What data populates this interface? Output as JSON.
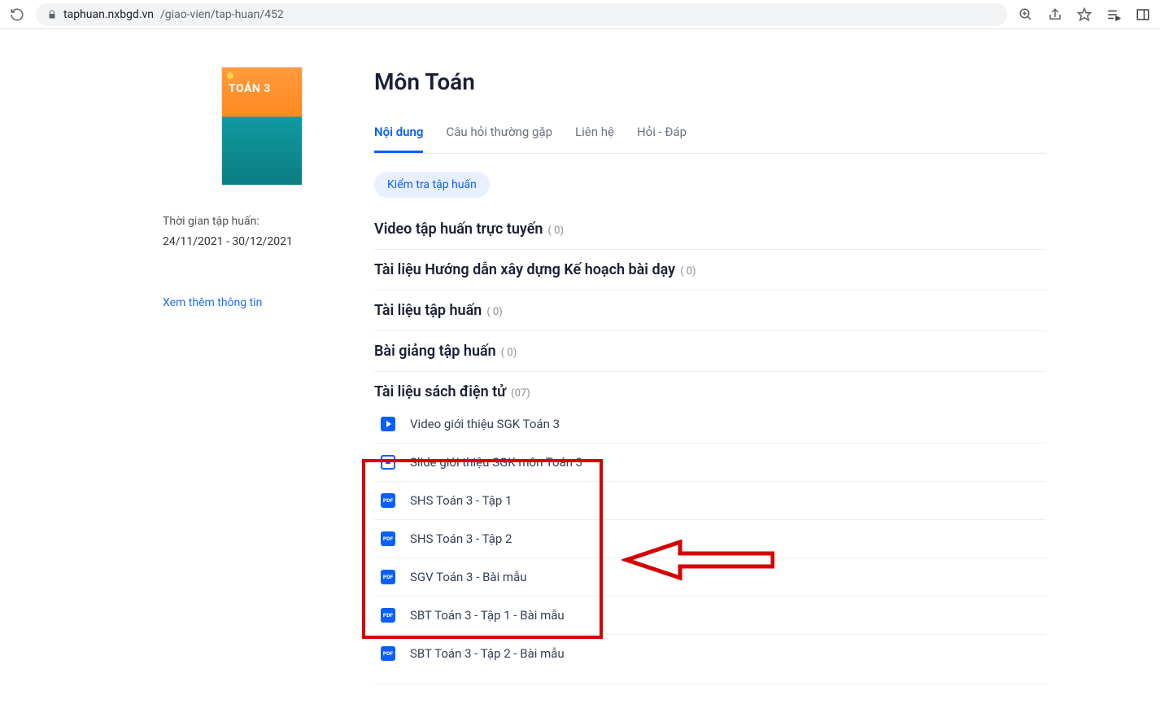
{
  "browser": {
    "url_host": "taphuan.nxbgd.vn",
    "url_path": "/giao-vien/tap-huan/452"
  },
  "sidebar": {
    "book_cover_text": "TOÁN 3",
    "period_label": "Thời gian tập huấn:",
    "period_dates": "24/11/2021 - 30/12/2021",
    "more_link": "Xem thêm thông tin"
  },
  "header": {
    "title": "Môn Toán"
  },
  "tabs": [
    {
      "label": "Nội dung",
      "active": true
    },
    {
      "label": "Câu hỏi thường gặp",
      "active": false
    },
    {
      "label": "Liên hệ",
      "active": false
    },
    {
      "label": "Hỏi - Đáp",
      "active": false
    }
  ],
  "check_button": "Kiểm tra tập huấn",
  "sections": [
    {
      "title": "Video tập huấn trực tuyến",
      "count": "( 0)",
      "items": []
    },
    {
      "title": "Tài liệu Hướng dẫn xây dựng Kế hoạch bài dạy",
      "count": "( 0)",
      "items": []
    },
    {
      "title": "Tài liệu tập huấn",
      "count": "( 0)",
      "items": []
    },
    {
      "title": "Bài giảng tập huấn",
      "count": "( 0)",
      "items": []
    },
    {
      "title": "Tài liệu sách điện tử",
      "count": "(07)",
      "items": [
        {
          "icon": "play",
          "label": "Video giới thiệu SGK Toán 3"
        },
        {
          "icon": "slide",
          "label": "Slide giới thiệu SGK môn Toán 3"
        },
        {
          "icon": "pdf",
          "label": "SHS Toán 3 - Tập 1"
        },
        {
          "icon": "pdf",
          "label": "SHS Toán 3 - Tập 2"
        },
        {
          "icon": "pdf",
          "label": "SGV Toán 3 - Bài mẫu"
        },
        {
          "icon": "pdf",
          "label": "SBT Toán 3 - Tập 1 - Bài mẫu"
        },
        {
          "icon": "pdf",
          "label": "SBT Toán 3 - Tập 2 - Bài mẫu"
        }
      ]
    }
  ]
}
